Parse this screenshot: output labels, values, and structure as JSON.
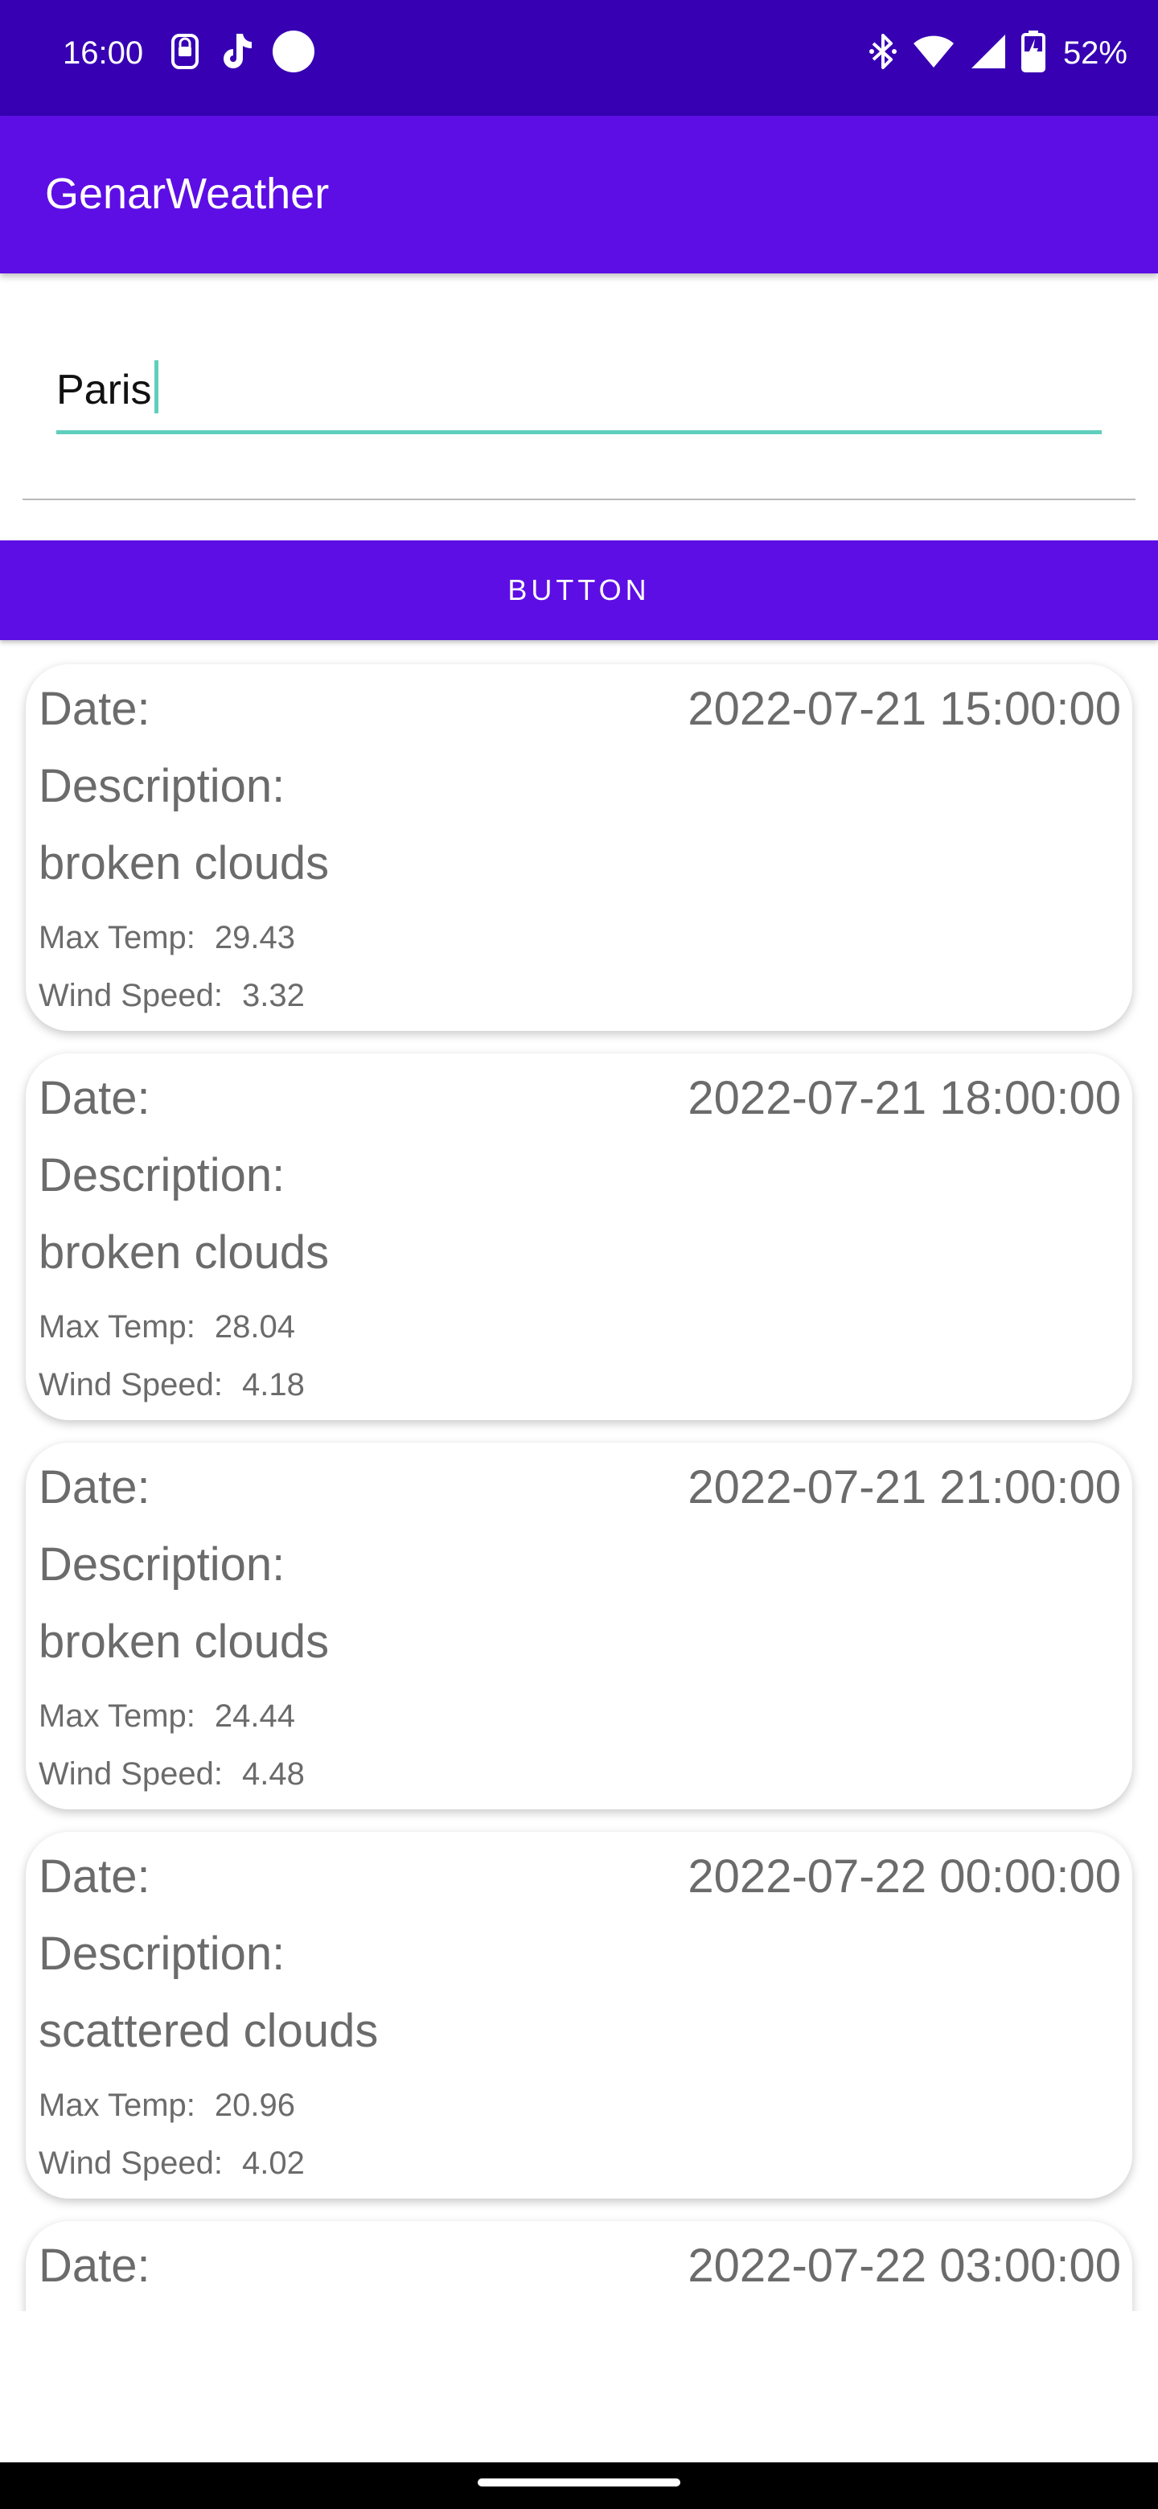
{
  "status_bar": {
    "time": "16:00",
    "battery": "52%",
    "left_icons": [
      "notification-lock-icon",
      "tiktok-icon",
      "dot-icon"
    ],
    "right_icons": [
      "bluetooth-icon",
      "wifi-icon",
      "signal-icon",
      "battery-charging-icon"
    ]
  },
  "app_bar": {
    "title": "GenarWeather"
  },
  "search": {
    "value": "Paris",
    "placeholder": ""
  },
  "button": {
    "label": "BUTTON"
  },
  "forecast_items": [
    {
      "date_label": "Date:",
      "date_value": "2022-07-21 15:00:00",
      "desc_label": "Description:",
      "desc_value": "broken clouds",
      "max_temp_label": "Max Temp:",
      "max_temp_value": "29.43",
      "wind_label": "Wind Speed:",
      "wind_value": "3.32"
    },
    {
      "date_label": "Date:",
      "date_value": "2022-07-21 18:00:00",
      "desc_label": "Description:",
      "desc_value": "broken clouds",
      "max_temp_label": "Max Temp:",
      "max_temp_value": "28.04",
      "wind_label": "Wind Speed:",
      "wind_value": "4.18"
    },
    {
      "date_label": "Date:",
      "date_value": "2022-07-21 21:00:00",
      "desc_label": "Description:",
      "desc_value": "broken clouds",
      "max_temp_label": "Max Temp:",
      "max_temp_value": "24.44",
      "wind_label": "Wind Speed:",
      "wind_value": "4.48"
    },
    {
      "date_label": "Date:",
      "date_value": "2022-07-22 00:00:00",
      "desc_label": "Description:",
      "desc_value": "scattered clouds",
      "max_temp_label": "Max Temp:",
      "max_temp_value": "20.96",
      "wind_label": "Wind Speed:",
      "wind_value": "4.02"
    },
    {
      "date_label": "Date:",
      "date_value": "2022-07-22 03:00:00"
    }
  ],
  "colors": {
    "status_bar": "#3700b3",
    "primary": "#5d0ee5",
    "accent": "#5fcfbd",
    "card_text": "#6b6b6b"
  }
}
